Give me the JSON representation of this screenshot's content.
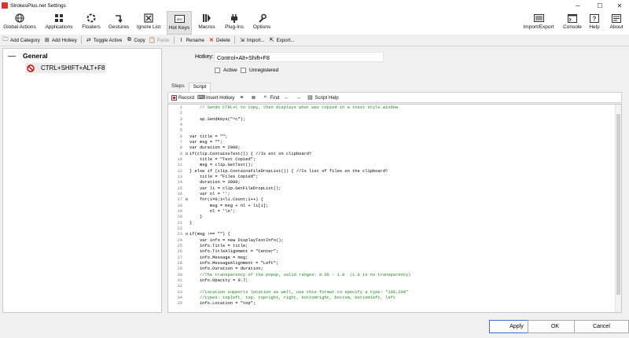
{
  "window": {
    "title": "StrokesPlus.net Settings",
    "minimize": "─",
    "maximize": "☐",
    "close": "✕"
  },
  "ribbon": {
    "left": [
      {
        "label": "Global Actions",
        "icon": "globe-icon"
      },
      {
        "label": "Applications",
        "icon": "applications-icon"
      },
      {
        "label": "Floaters",
        "icon": "floaters-icon"
      },
      {
        "label": "Gestures",
        "icon": "gestures-icon"
      },
      {
        "label": "Ignore List",
        "icon": "ignore-list-icon"
      },
      {
        "label": "Hot Keys",
        "icon": "hotkeys-icon"
      },
      {
        "label": "Macros",
        "icon": "macros-icon"
      },
      {
        "label": "Plug-Ins",
        "icon": "plugins-icon"
      },
      {
        "label": "Options",
        "icon": "options-icon"
      }
    ],
    "right": [
      {
        "label": "Import/Export",
        "icon": "import-export-icon"
      },
      {
        "label": "Console",
        "icon": "console-icon"
      },
      {
        "label": "Help",
        "icon": "help-icon"
      },
      {
        "label": "About",
        "icon": "about-icon"
      }
    ],
    "active": "Hot Keys"
  },
  "toolbar": {
    "add_category": "Add Category",
    "add_hotkey": "Add Hotkey",
    "toggle_active": "Toggle Active",
    "copy": "Copy",
    "paste": "Paste",
    "rename": "Rename",
    "delete": "Delete",
    "import": "Import...",
    "export": "Export..."
  },
  "tree": {
    "category": "General",
    "item": "CTRL+SHIFT+ALT+F8"
  },
  "hotkey": {
    "label": "Hotkey:",
    "value": "Control+Alt+Shift+F8"
  },
  "checks": {
    "active": "Active",
    "unregistered": "Unregistered"
  },
  "tabs": {
    "steps": "Steps",
    "script": "Script"
  },
  "editor_toolbar": {
    "record": "Record",
    "insert_hotkey": "Insert Hotkey",
    "find": "Find",
    "script_help": "Script Help"
  },
  "code_lines": [
    {
      "n": "1",
      "f": "",
      "t": "    // Sends CTRL+C to copy, then displays what was copied in a toast style window",
      "c": "comment"
    },
    {
      "n": "2",
      "f": "",
      "t": "",
      "c": "plain"
    },
    {
      "n": "3",
      "f": "",
      "t": "    sp.SendKeys(\"^c\");",
      "c": "plain"
    },
    {
      "n": "4",
      "f": "",
      "t": "",
      "c": "plain"
    },
    {
      "n": "5",
      "f": "",
      "t": "",
      "c": "plain"
    },
    {
      "n": "6",
      "f": "",
      "t": "var title = \"\";",
      "c": "plain"
    },
    {
      "n": "7",
      "f": "",
      "t": "var msg = \"\";",
      "c": "plain"
    },
    {
      "n": "8",
      "f": "",
      "t": "var duration = 2000;",
      "c": "plain"
    },
    {
      "n": "9",
      "f": "⊟",
      "t": "if(clip.ContainsText()) { //Is ext on clipboard?",
      "c": "plain"
    },
    {
      "n": "10",
      "f": "",
      "t": "    title = \"Text Copied\";",
      "c": "plain"
    },
    {
      "n": "11",
      "f": "",
      "t": "    msg = clip.GetText();",
      "c": "plain"
    },
    {
      "n": "12",
      "f": "",
      "t": "} else if (clip.ContainsFileDropList()) { //Is list of files on the clipboard?",
      "c": "plain"
    },
    {
      "n": "13",
      "f": "",
      "t": "    title = \"Files Copied\";",
      "c": "plain"
    },
    {
      "n": "14",
      "f": "",
      "t": "    duration = 3000;",
      "c": "plain"
    },
    {
      "n": "15",
      "f": "",
      "t": "    var li = clip.GetFileDropList();",
      "c": "plain"
    },
    {
      "n": "16",
      "f": "",
      "t": "    var nl = '';",
      "c": "plain"
    },
    {
      "n": "17",
      "f": "⊟",
      "t": "    for(i=0;i<li.Count;i++) {",
      "c": "plain"
    },
    {
      "n": "18",
      "f": "",
      "t": "        msg = msg + nl + li[i];",
      "c": "plain"
    },
    {
      "n": "19",
      "f": "",
      "t": "        nl = '\\n';",
      "c": "plain"
    },
    {
      "n": "20",
      "f": "",
      "t": "    }",
      "c": "plain"
    },
    {
      "n": "21",
      "f": "",
      "t": "}",
      "c": "plain"
    },
    {
      "n": "22",
      "f": "",
      "t": "",
      "c": "plain"
    },
    {
      "n": "23",
      "f": "⊟",
      "t": "if(msg !== \"\") {",
      "c": "plain"
    },
    {
      "n": "24",
      "f": "",
      "t": "    var info = new DisplayTextInfo();",
      "c": "plain"
    },
    {
      "n": "25",
      "f": "",
      "t": "    info.Title = title;",
      "c": "plain"
    },
    {
      "n": "26",
      "f": "",
      "t": "    info.TitleAlignment = \"Center\";",
      "c": "plain"
    },
    {
      "n": "27",
      "f": "",
      "t": "    info.Message = msg;",
      "c": "plain"
    },
    {
      "n": "28",
      "f": "",
      "t": "    info.MessageAlignment = \"Left\";",
      "c": "plain"
    },
    {
      "n": "29",
      "f": "",
      "t": "    info.Duration = duration;",
      "c": "plain"
    },
    {
      "n": "30",
      "f": "",
      "t": "    //The transparency of the popup, valid ranges: 0.05 - 1.0  (1.0 is no transparency)",
      "c": "comment"
    },
    {
      "n": "31",
      "f": "",
      "t": "    info.Opacity = 0.7;",
      "c": "plain"
    },
    {
      "n": "32",
      "f": "",
      "t": "",
      "c": "plain"
    },
    {
      "n": "33",
      "f": "",
      "t": "    //Location supports location as well, use this format to specify a type: \"100,200\"",
      "c": "comment"
    },
    {
      "n": "34",
      "f": "",
      "t": "    //types: topleft, top, topright, right, bottomright, bottom, bottomleft, left",
      "c": "comment"
    },
    {
      "n": "35",
      "f": "",
      "t": "    info.Location = \"top\";",
      "c": "plain"
    }
  ],
  "footer": {
    "apply": "Apply",
    "ok": "OK",
    "cancel": "Cancel"
  },
  "colors": {
    "comment": "#1a8a1a",
    "string": "#b2361e",
    "keyword": "#1a1ad6",
    "method": "#b000b0",
    "accent": "#3a6fd8"
  }
}
